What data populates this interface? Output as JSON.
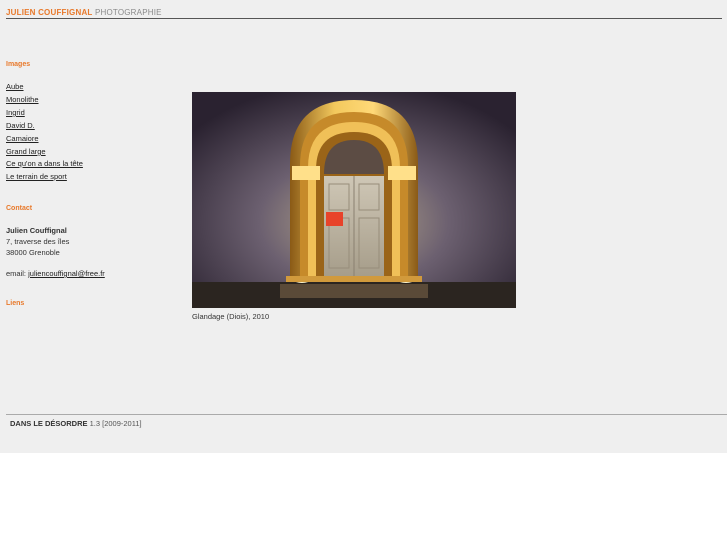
{
  "header": {
    "site_name": "JULIEN COUFFIGNAL",
    "site_tagline": "PHOTOGRAPHIE"
  },
  "sidebar": {
    "images_title": "Images",
    "image_links": [
      "Aube",
      "Monolithe",
      "Ingrid",
      "David D.",
      "Camaiore",
      "Grand large",
      "Ce qu'on a dans la tête",
      "Le terrain de sport"
    ],
    "contact_title": "Contact",
    "contact": {
      "name": "Julien Couffignal",
      "address_line1": "7, traverse des îles",
      "address_line2": "38000 Grenoble",
      "email_label": "email:",
      "email": "juliencouffignal@free.fr"
    },
    "links_title": "Liens"
  },
  "main": {
    "photo_caption": "Glandage (Diois), 2010"
  },
  "footer": {
    "brand": "DANS LE DÉSORDRE",
    "version_text": "1.3 [2009-2011]"
  },
  "colors": {
    "accent": "#e8792b",
    "page_background": "#efefef"
  }
}
